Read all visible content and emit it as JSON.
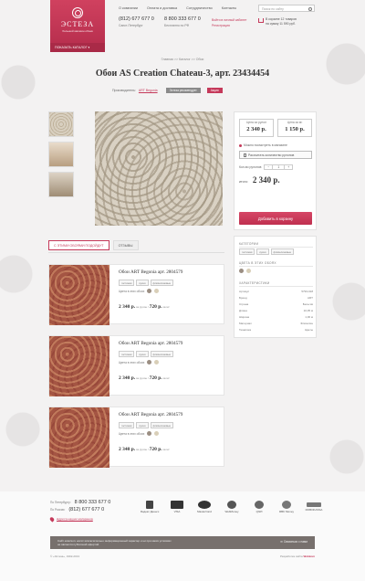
{
  "header": {
    "logo_name": "ЭСТЕЗА",
    "logo_tagline": "большой магазин обоев",
    "catalog_button": "ПОКАЗАТЬ КАТАЛОГ",
    "nav": [
      "О компании",
      "Оплата и доставка",
      "Сотрудничество",
      "Контакты"
    ],
    "phone_spb": "(812) 677 677 0",
    "phone_free": "8 800 333 677 0",
    "city": "Санкт-Петербург",
    "city2": "Бесплатно по РФ",
    "links": [
      "Войти в личный кабинет",
      "Регистрация"
    ],
    "search_placeholder": "Поиск по сайту",
    "cart_line1": "В корзине 12 товаров",
    "cart_line2": "на сумму 11 590 руб."
  },
  "breadcrumb": "Главная  >>  Каталог  >>  Обои",
  "product": {
    "title": "Обои AS Creation Chateau-3, арт. 23434454",
    "manufacturer_label": "Производитель:",
    "manufacturer": "ART Begonia",
    "tag_recommend": "Эстеза рекомендует",
    "tag_sale": "Акция",
    "price_roll_label": "Цена за рулон",
    "price_roll": "2 340 р.",
    "price_m2_label": "Цена за м²",
    "price_m2": "1 150 р.",
    "available": "Можно посмотреть в магазине",
    "calc_button": "Рассчитать количество рулонов",
    "qty_label": "Кол-во рулонов",
    "qty_value": "1",
    "total_label": "итого:",
    "total": "2 340 р.",
    "add_button": "Добавить в корзину"
  },
  "tabs": [
    "С ЭТИМИ ОБОЯМИ ПОДОЙДУТ",
    "ОТЗЫВЫ"
  ],
  "items": [
    {
      "title": "Обои ART Begonia арт. 2804579",
      "tags": [
        "гостиная",
        "кухня",
        "флизелиновые"
      ],
      "colors_label": "Цвета в этих обоях",
      "price": "2 340 р.",
      "price_unit": "за рулон",
      "price_m2": "720 р.",
      "price_m2_unit": "за м²"
    },
    {
      "title": "Обои ART Begonia арт. 2804579",
      "tags": [
        "гостиная",
        "кухня",
        "флизелиновые"
      ],
      "colors_label": "Цвета в этих обоях",
      "price": "2 340 р.",
      "price_unit": "за рулон",
      "price_m2": "720 р.",
      "price_m2_unit": "за м²"
    },
    {
      "title": "Обои ART Begonia арт. 2804579",
      "tags": [
        "гостиная",
        "кухня",
        "флизелиновые"
      ],
      "colors_label": "Цвета в этих обоях",
      "price": "2 340 р.",
      "price_unit": "за рулон",
      "price_m2": "720 р.",
      "price_m2_unit": "за м²"
    }
  ],
  "sidebar": {
    "categories_title": "КАТЕГОРИИ",
    "categories": [
      "гостиная",
      "кухня",
      "флизелиновые"
    ],
    "colors_title": "ЦВЕТА В ЭТИХ ОБОЯХ",
    "specs_title": "ХАРАКТЕРИСТИКИ",
    "specs": [
      [
        "Артикул",
        "5793-018"
      ],
      [
        "Бренд",
        "ART"
      ],
      [
        "Страна",
        "Бельгия"
      ],
      [
        "Длина",
        "10,05 м"
      ],
      [
        "Ширина",
        "1,06 м"
      ],
      [
        "Материал",
        "Флизелин"
      ],
      [
        "Тематика",
        "Цветы"
      ]
    ]
  },
  "colors": {
    "accent": "#c5395a",
    "swatch1": "#9b8e82",
    "swatch2": "#d9cfb8"
  },
  "footer": {
    "spb_label": "По Петербургу:",
    "spb_phone": "(812) 677 677 0",
    "rf_label": "По России:",
    "rf_phone": "8 800 333 677 0",
    "address_link": "Адреса наших магазинов",
    "payments": [
      "Яндекс Деньги",
      "VISA",
      "MasterCard",
      "WebMoney",
      "QIWI",
      "RBK Money",
      "ROBOKASSA"
    ],
    "disclaimer1": "Сайт estezа.ru носит исключительно информационный характер и ни при каких условиях",
    "disclaimer2": "не является публичной офертой.",
    "social": "Связаться с нами",
    "copyright": "© «Эстеза», 1992-2013",
    "dev_label": "Разработка сайта",
    "dev_name": "Webkom"
  }
}
